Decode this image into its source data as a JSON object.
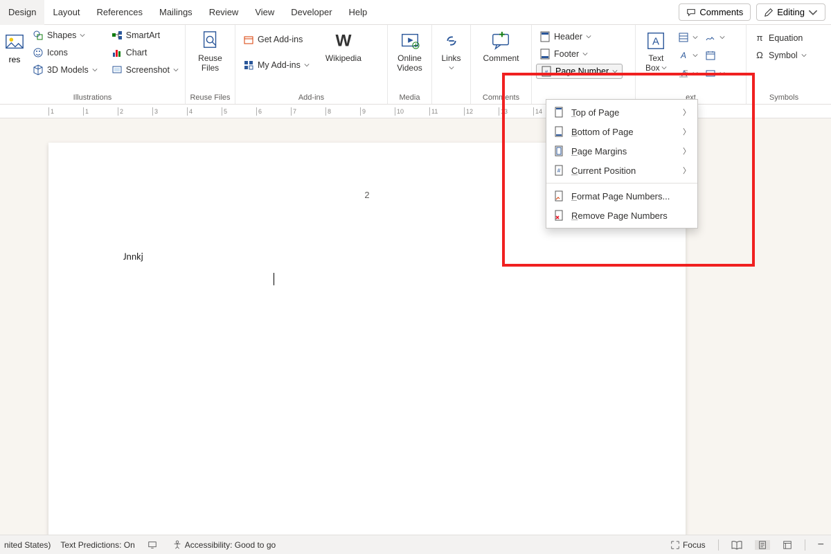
{
  "tabs": {
    "design": "Design",
    "layout": "Layout",
    "references": "References",
    "mailings": "Mailings",
    "review": "Review",
    "view": "View",
    "developer": "Developer",
    "help": "Help"
  },
  "top_buttons": {
    "comments": "Comments",
    "editing": "Editing"
  },
  "ribbon": {
    "illustrations": {
      "label": "Illustrations",
      "shapes": "Shapes",
      "icons": "Icons",
      "models3d": "3D Models",
      "smartart": "SmartArt",
      "chart": "Chart",
      "screenshot": "Screenshot",
      "pictures_trunc": "res"
    },
    "reuse": {
      "label": "Reuse Files",
      "btn1": "Reuse",
      "btn2": "Files"
    },
    "addins": {
      "label": "Add-ins",
      "get": "Get Add-ins",
      "my": "My Add-ins",
      "wikipedia": "Wikipedia"
    },
    "media": {
      "label": "Media",
      "online1": "Online",
      "online2": "Videos"
    },
    "links": {
      "label": "",
      "btn": "Links"
    },
    "comments": {
      "label": "Comments",
      "btn": "Comment"
    },
    "headerfooter": {
      "header": "Header",
      "footer": "Footer",
      "pagenum": "Page Number"
    },
    "text": {
      "box": "Text",
      "box2": "Box",
      "label": "ext"
    },
    "symbols": {
      "label": "Symbols",
      "equation": "Equation",
      "symbol": "Symbol"
    }
  },
  "menu": {
    "top": "Top of Page",
    "bottom": "Bottom of Page",
    "margins": "Page Margins",
    "current": "Current Position",
    "format": "Format Page Numbers...",
    "remove": "Remove Page Numbers"
  },
  "document": {
    "page_number": "2",
    "text": "Jnnkj"
  },
  "status": {
    "lang": "nited States)",
    "predictions": "Text Predictions: On",
    "accessibility": "Accessibility: Good to go",
    "focus": "Focus"
  },
  "ruler_marks": [
    "1",
    "1",
    "2",
    "3",
    "4",
    "5",
    "6",
    "7",
    "8",
    "9",
    "10",
    "11",
    "12",
    "13",
    "14"
  ]
}
